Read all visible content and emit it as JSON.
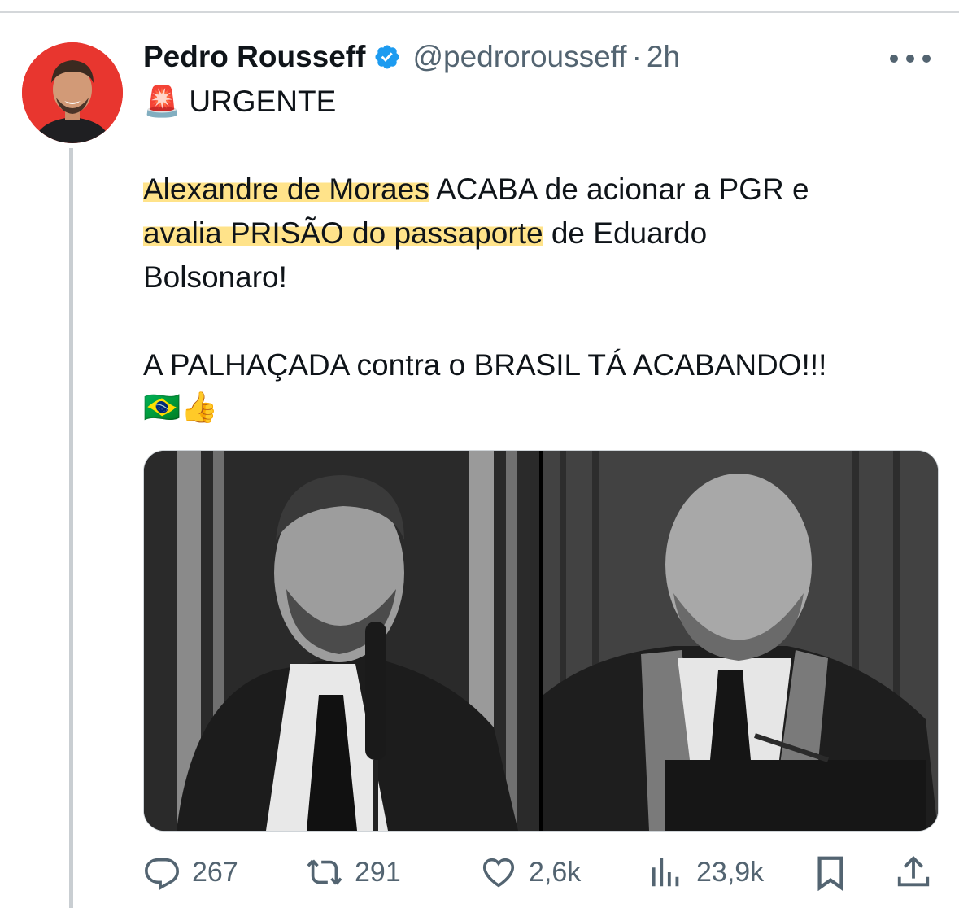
{
  "tweet": {
    "author": {
      "name": "Pedro Rousseff",
      "handle": "@pedrorousseff",
      "separator": "·",
      "time": "2h"
    },
    "line1": "🚨 URGENTE",
    "body": {
      "p1_hl1": "Alexandre de Moraes",
      "p1_t1": " ACABA de acionar a PGR e",
      "p1_hl2": "avalia PRISÃO do passaporte",
      "p1_t2": " de Eduardo",
      "p1_t3": "Bolsonaro!",
      "p2_line1": "A PALHAÇADA contra o BRASIL TÁ ACABANDO!!!",
      "p2_emoji": "🇧🇷👍"
    },
    "stats": {
      "replies": "267",
      "retweets": "291",
      "likes": "2,6k",
      "views": "23,9k"
    }
  },
  "icons": {
    "verified": "verified-badge-icon",
    "more": "more-icon",
    "reply": "reply-icon",
    "retweet": "retweet-icon",
    "like": "heart-icon",
    "views": "views-icon",
    "bookmark": "bookmark-icon",
    "share": "share-icon"
  },
  "colors": {
    "highlight": "#ffe38a",
    "verified": "#1d9bf0",
    "secondary_text": "#536471"
  }
}
